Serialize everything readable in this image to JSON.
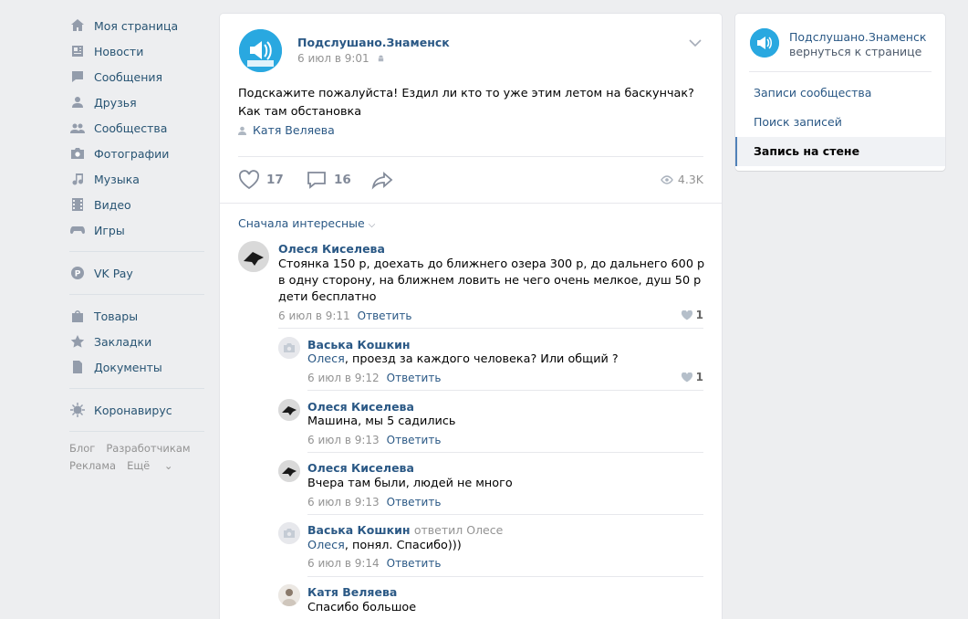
{
  "nav": {
    "items": [
      {
        "label": "Моя страница",
        "icon": "home-icon"
      },
      {
        "label": "Новости",
        "icon": "news-icon"
      },
      {
        "label": "Сообщения",
        "icon": "messages-icon"
      },
      {
        "label": "Друзья",
        "icon": "friends-icon"
      },
      {
        "label": "Сообщества",
        "icon": "groups-icon"
      },
      {
        "label": "Фотографии",
        "icon": "camera-icon"
      },
      {
        "label": "Музыка",
        "icon": "music-icon"
      },
      {
        "label": "Видео",
        "icon": "video-icon"
      },
      {
        "label": "Игры",
        "icon": "games-icon"
      },
      {
        "label": "VK Pay",
        "icon": "vkpay-icon"
      },
      {
        "label": "Товары",
        "icon": "bag-icon"
      },
      {
        "label": "Закладки",
        "icon": "star-icon"
      },
      {
        "label": "Документы",
        "icon": "document-icon"
      },
      {
        "label": "Коронавирус",
        "icon": "virus-icon"
      }
    ],
    "footer": {
      "blog": "Блог",
      "dev": "Разработчикам",
      "ads": "Реклама",
      "more": "Ещё"
    }
  },
  "post": {
    "group_name": "Подслушано.Знаменск",
    "date": "6 июл в 9:01",
    "text": "Подскажите пожалуйста! Ездил ли кто то уже этим летом на баскунчак? Как там обстановка",
    "signer": "Катя Веляева",
    "likes": "17",
    "comments": "16",
    "views": "4.3K",
    "sort_label": "Сначала интересные"
  },
  "comments": [
    {
      "author": "Олеся Киселева",
      "text": "Стоянка 150 р, доехать до ближнего озера 300 р, до дальнего 600 р в одну сторону, на ближнем ловить не чего очень мелкое, душ 50 р дети бесплатно",
      "date": "6 июл в 9:11",
      "reply": "Ответить",
      "likes": "1"
    },
    {
      "author": "Васька Кошкин",
      "to": "Олеся",
      "text": ", проезд за каждого человека? Или общий ?",
      "date": "6 июл в 9:12",
      "reply": "Ответить",
      "likes": "1"
    },
    {
      "author": "Олеся Киселева",
      "text": "Машина, мы 5 садились",
      "date": "6 июл в 9:13",
      "reply": "Ответить"
    },
    {
      "author": "Олеся Киселева",
      "text": "Вчера там были, людей не много",
      "date": "6 июл в 9:13",
      "reply": "Ответить"
    },
    {
      "author": "Васька Кошкин",
      "replied": "ответил Олесе",
      "to": "Олеся",
      "text": ", понял. Спасибо)))",
      "date": "6 июл в 9:14",
      "reply": "Ответить"
    },
    {
      "author": "Катя Веляева",
      "text": "Спасибо большое"
    }
  ],
  "side": {
    "group_name": "Подслушано.Знаменск",
    "back": "вернуться к странице",
    "links": [
      "Записи сообщества",
      "Поиск записей",
      "Запись на стене"
    ]
  },
  "colors": {
    "accent": "#2a5885",
    "background": "#edeef0",
    "logo": "#29a8e0"
  }
}
